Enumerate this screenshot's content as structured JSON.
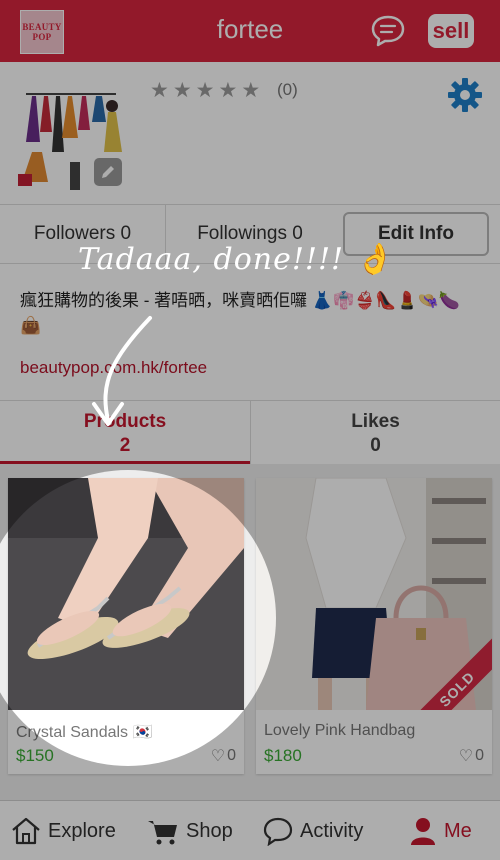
{
  "header": {
    "logo_text": "BEAUTY POP",
    "title": "fortee",
    "sell_label": "sell"
  },
  "profile": {
    "stars": [
      "★",
      "★",
      "★",
      "★",
      "★"
    ],
    "rating_count": "(0)"
  },
  "stats": {
    "followers": "Followers 0",
    "followings": "Followings 0",
    "edit_info": "Edit Info"
  },
  "bio": {
    "text": "瘋狂購物的後果 - 著唔晒，咪賣晒佢囉 👗👘👙👠💄👒🍆👜",
    "link": "beautypop.com.hk/fortee"
  },
  "tabs": [
    {
      "label": "Products",
      "count": "2"
    },
    {
      "label": "Likes",
      "count": "0"
    }
  ],
  "products": [
    {
      "title": "Crystal Sandals 🇰🇷",
      "price": "$150",
      "likes": "0",
      "sold": false
    },
    {
      "title": "Lovely Pink Handbag",
      "price": "$180",
      "likes": "0",
      "sold": true,
      "sold_label": "SOLD"
    }
  ],
  "nav": [
    {
      "label": "Explore"
    },
    {
      "label": "Shop"
    },
    {
      "label": "Activity"
    },
    {
      "label": "Me"
    }
  ],
  "overlay": {
    "caption": "Tadaaa, done!!!! 👌"
  },
  "colors": {
    "brand": "#d8263e",
    "price": "#3aaa35",
    "active_tab": "#c4172e"
  }
}
